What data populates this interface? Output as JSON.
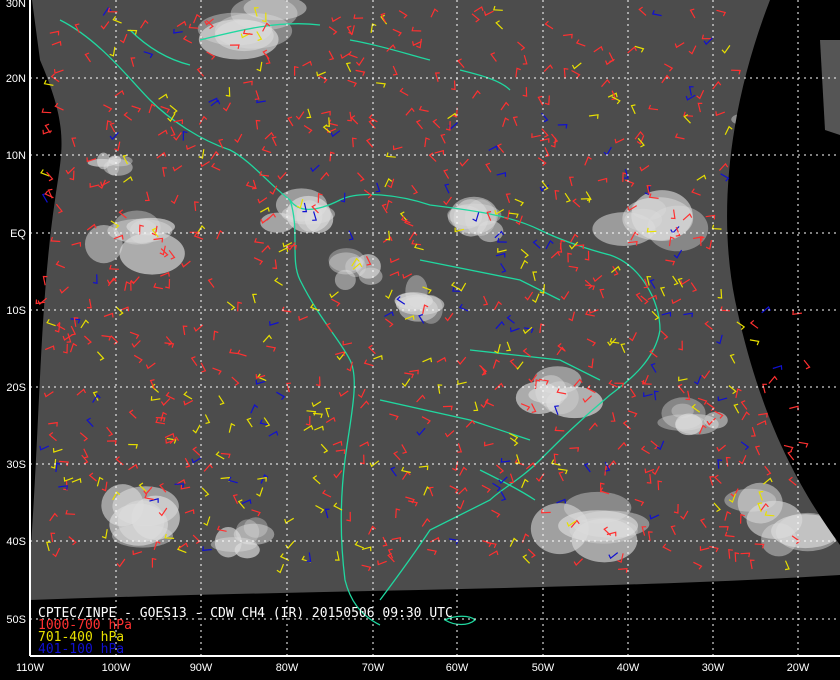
{
  "title": "CPTEC/INPE - GOES13 - CDW CH4 (IR) 20150506 09:30 UTC",
  "legend": [
    {
      "label": "1000-700 hPa",
      "color": "#ff3030"
    },
    {
      "label": "701-400 hPa",
      "color": "#e8e000"
    },
    {
      "label": "401-100 hPa",
      "color": "#1010d0"
    }
  ],
  "lat_labels": [
    "30N",
    "20N",
    "10N",
    "EQ",
    "10S",
    "20S",
    "30S",
    "40S",
    "50S"
  ],
  "lon_labels": [
    "110W",
    "100W",
    "90W",
    "80W",
    "70W",
    "60W",
    "50W",
    "40W",
    "30W",
    "20W"
  ],
  "colors": {
    "coast": "#20d8a0",
    "satellite": "#5a5a5a",
    "grid": "#ffffff"
  }
}
